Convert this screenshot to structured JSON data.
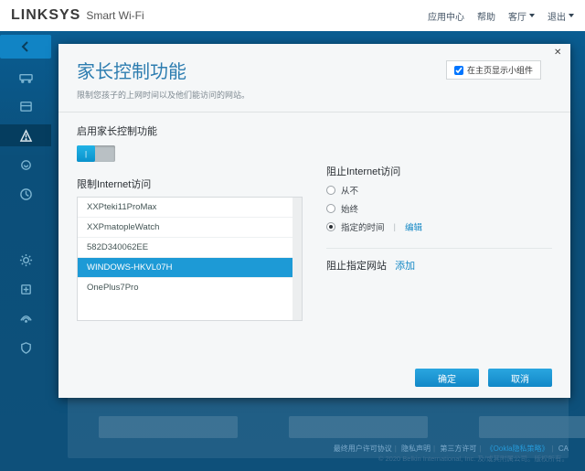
{
  "header": {
    "brand": "LINKSYS",
    "brandSub": "Smart Wi-Fi",
    "nav": {
      "appCenter": "应用中心",
      "help": "帮助",
      "room": "客厅",
      "logout": "退出"
    }
  },
  "modal": {
    "title": "家长控制功能",
    "subtitle": "限制您孩子的上网时间以及他们能访问的网站。",
    "showWidgetLabel": "在主页显示小组件",
    "enableLabel": "启用家长控制功能",
    "restrictLabel": "限制Internet访问",
    "devices": [
      "XXPteki11ProMax",
      "XXPmatopleWatch",
      "582D340062EE",
      "WINDOWS-HKVL07H",
      "OnePlus7Pro"
    ],
    "selectedDeviceIndex": 3,
    "blockAccessLabel": "阻止Internet访问",
    "radios": {
      "never": "从不",
      "always": "始终",
      "scheduled": "指定的时间"
    },
    "editLink": "编辑",
    "blockSitesLabel": "阻止指定网站",
    "addLink": "添加",
    "okBtn": "确定",
    "cancelBtn": "取消"
  },
  "footer": {
    "eula": "最终用户许可协议",
    "privacy": "隐私声明",
    "thirdParty": "第三方许可",
    "ookla": "《Ookla隐私策略》",
    "ca": "CA",
    "copyright": "© 2020 Belkin International, Inc. 及/或其附属公司。版权所有。"
  }
}
